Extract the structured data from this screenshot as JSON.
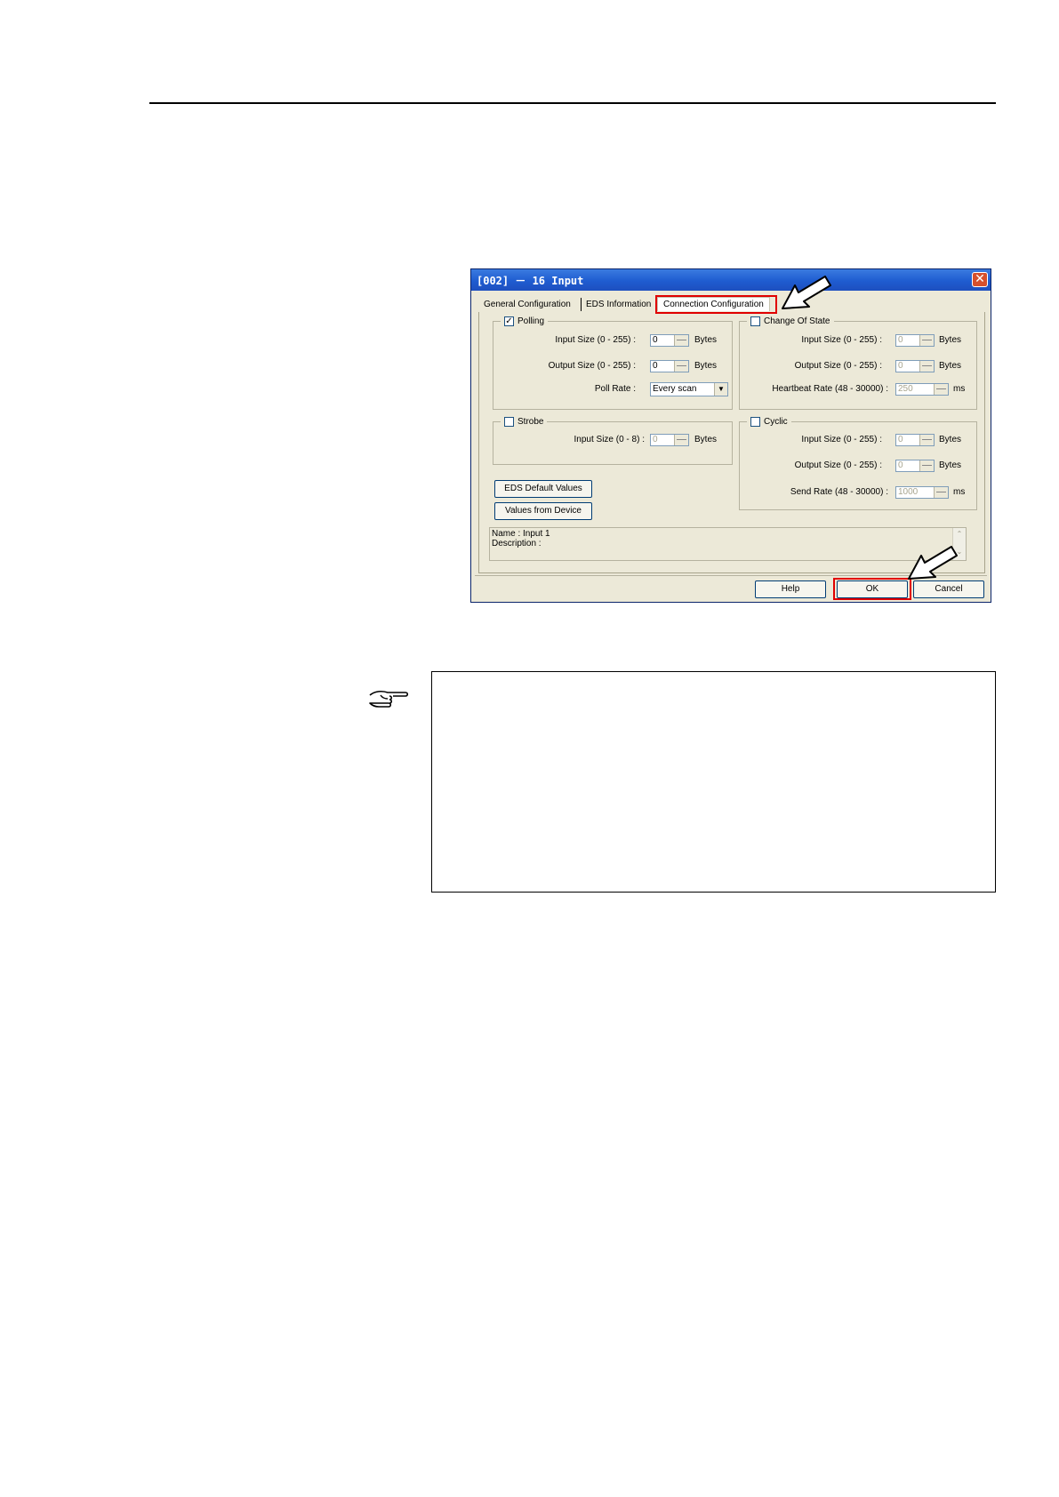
{
  "dialog": {
    "title": "[002] － 16 Input",
    "close_glyph": "✕",
    "tabs": [
      "General Configuration",
      "EDS Information",
      "Connection Configuration"
    ],
    "polling": {
      "label": "Polling",
      "checked": true,
      "input_size_label": "Input Size (0 - 255) :",
      "input_size_value": "0",
      "output_size_label": "Output Size (0 - 255) :",
      "output_size_value": "0",
      "unit": "Bytes",
      "poll_rate_label": "Poll Rate :",
      "poll_rate_value": "Every scan"
    },
    "change_of_state": {
      "label": "Change Of State",
      "checked": false,
      "input_size_label": "Input Size (0 - 255) :",
      "input_size_value": "0",
      "output_size_label": "Output Size (0 - 255) :",
      "output_size_value": "0",
      "unit": "Bytes",
      "heartbeat_label": "Heartbeat Rate (48 - 30000) :",
      "heartbeat_value": "250",
      "heartbeat_unit": "ms"
    },
    "strobe": {
      "label": "Strobe",
      "checked": false,
      "input_size_label": "Input Size (0 - 8) :",
      "input_size_value": "0",
      "unit": "Bytes"
    },
    "cyclic": {
      "label": "Cyclic",
      "checked": false,
      "input_size_label": "Input Size (0 - 255) :",
      "input_size_value": "0",
      "output_size_label": "Output Size (0 - 255) :",
      "output_size_value": "0",
      "unit": "Bytes",
      "send_rate_label": "Send Rate (48 - 30000) :",
      "send_rate_value": "1000",
      "send_rate_unit": "ms"
    },
    "buttons": {
      "eds_default": "EDS Default Values",
      "values_from_device": "Values from Device",
      "help": "Help",
      "ok": "OK",
      "cancel": "Cancel"
    },
    "info": {
      "name": "Name : Input 1",
      "description": "Description :"
    }
  },
  "note": {
    "icon": "pointing-hand-icon"
  },
  "colors": {
    "highlight": "#e00000",
    "titlebar": "#1f5cd0",
    "dialog_bg": "#ece9d8"
  }
}
